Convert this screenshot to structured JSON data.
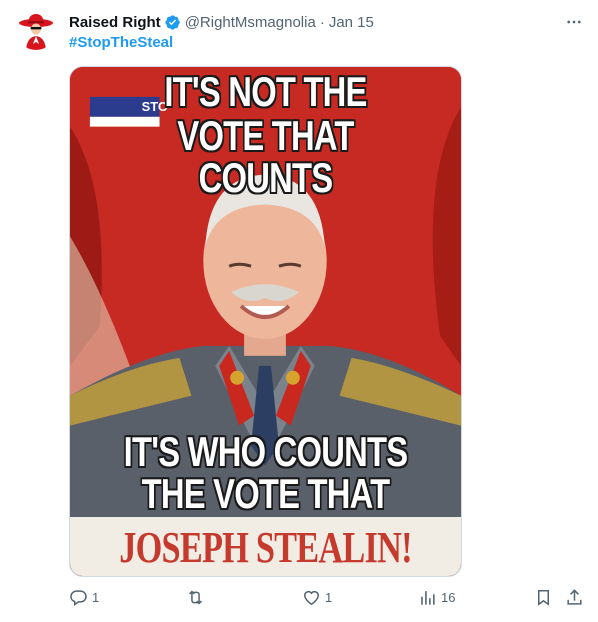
{
  "author": {
    "display_name": "Raised Right",
    "handle": "@RightMsmagnolia",
    "separator": "·",
    "time": "Jan 15",
    "verified": true
  },
  "tweet": {
    "hashtag": "#StopTheSteal"
  },
  "media": {
    "top_line_1": "IT'S NOT THE",
    "top_line_2": "VOTE THAT COUNTS",
    "bottom_line_1": "IT'S WHO COUNTS",
    "bottom_line_2": "THE VOTE THAT COUNTS",
    "caption": "JOSEPH STEALIN!",
    "banner_fragment": "STO"
  },
  "actions": {
    "replies": "1",
    "reposts": "",
    "likes": "1",
    "views": "16"
  },
  "colors": {
    "accent": "#1d9bf0",
    "muted": "#536471",
    "poster_red": "#c62a22",
    "caption_red": "#c63a2e"
  },
  "icons": [
    "avatar-hat",
    "verified-badge-icon",
    "more-icon",
    "reply-icon",
    "repost-icon",
    "like-icon",
    "views-icon",
    "bookmark-icon",
    "share-icon"
  ]
}
